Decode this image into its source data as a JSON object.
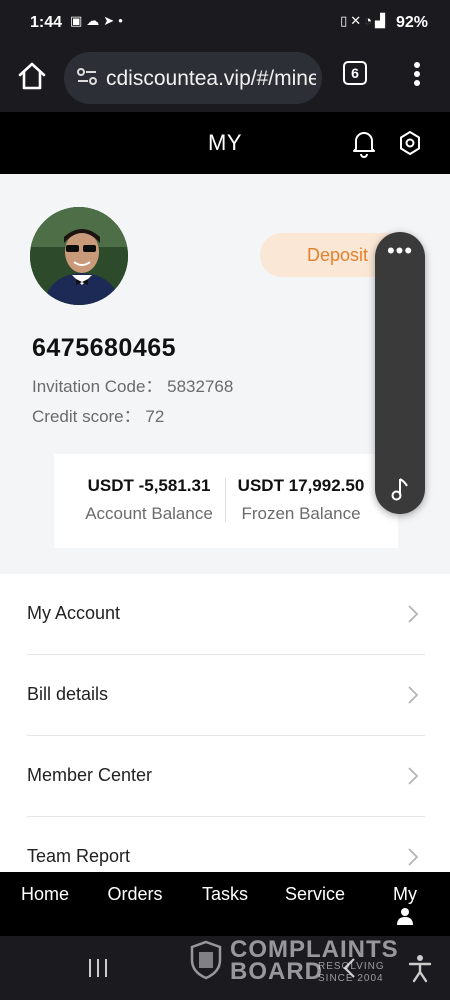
{
  "status_bar": {
    "time": "1:44",
    "notification_icons": [
      "image-icon",
      "cloud-icon",
      "telegram-icon",
      "dot-icon"
    ],
    "system_icons": [
      "vibrate-icon",
      "mute-icon",
      "wifi-icon",
      "signal-icon"
    ],
    "battery": "92%"
  },
  "browser": {
    "url": "cdiscountea.vip/#/mine",
    "tab_count": "6"
  },
  "header": {
    "title": "MY"
  },
  "profile": {
    "deposit_label": "Deposit",
    "user_id": "6475680465",
    "invitation_code": "Invitation Code： 5832768",
    "credit_score": "Credit score： 72"
  },
  "balances": [
    {
      "amount": "USDT -5,581.31",
      "label": "Account Balance"
    },
    {
      "amount": "USDT 17,992.50",
      "label": "Frozen Balance"
    }
  ],
  "floating_widget": {
    "more_label": "•••"
  },
  "menu": [
    {
      "label": "My Account"
    },
    {
      "label": "Bill details"
    },
    {
      "label": "Member Center"
    },
    {
      "label": "Team Report"
    }
  ],
  "tabs": [
    {
      "label": "Home"
    },
    {
      "label": "Orders"
    },
    {
      "label": "Tasks"
    },
    {
      "label": "Service"
    },
    {
      "label": "My"
    }
  ],
  "watermark": {
    "line1": "COMPLAINTS",
    "line2": "BOARD",
    "line3": "RESOLVING",
    "line4": "SINCE 2004"
  },
  "colors": {
    "deposit_bg": "#fbe7d5",
    "deposit_text": "#e3812d",
    "header_bg": "#000000",
    "page_bg": "#f4f5f7"
  }
}
